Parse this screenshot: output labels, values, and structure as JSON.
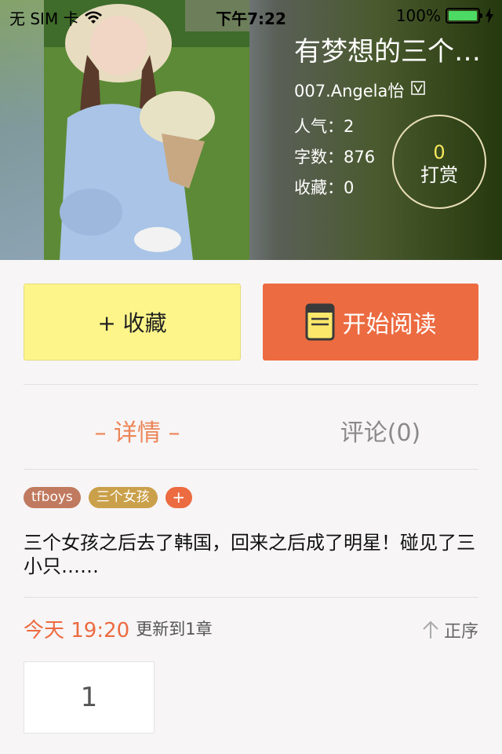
{
  "status_bar": {
    "carrier": "无 SIM 卡",
    "time": "下午7:22",
    "battery": "100%"
  },
  "book": {
    "title": "有梦想的三个女孩",
    "author": "007.Angela怡",
    "stats": [
      {
        "label": "人气：",
        "value": "2"
      },
      {
        "label": "字数：",
        "value": "876"
      },
      {
        "label": "收藏：",
        "value": "0"
      }
    ],
    "reward": {
      "count": "0",
      "label": "打赏"
    }
  },
  "actions": {
    "favorite_label": "+ 收藏",
    "read_label": "开始阅读"
  },
  "tabs": {
    "detail": "– 详情 –",
    "comments": "评论(0)"
  },
  "tags": [
    {
      "label": "tfboys",
      "color": "#c07a5f"
    },
    {
      "label": "三个女孩",
      "color": "#caa04a"
    }
  ],
  "tag_add_label": "+",
  "description": "三个女孩之后去了韩国，回来之后成了明星！碰见了三小只……",
  "update": {
    "time": "今天 19:20",
    "chapter": "更新到1章",
    "sort_label": "正序"
  },
  "chapters": [
    "1"
  ],
  "colors": {
    "accent": "#ec6b41",
    "favorite_bg": "#fdf58a",
    "tab_active": "#ec8558"
  }
}
